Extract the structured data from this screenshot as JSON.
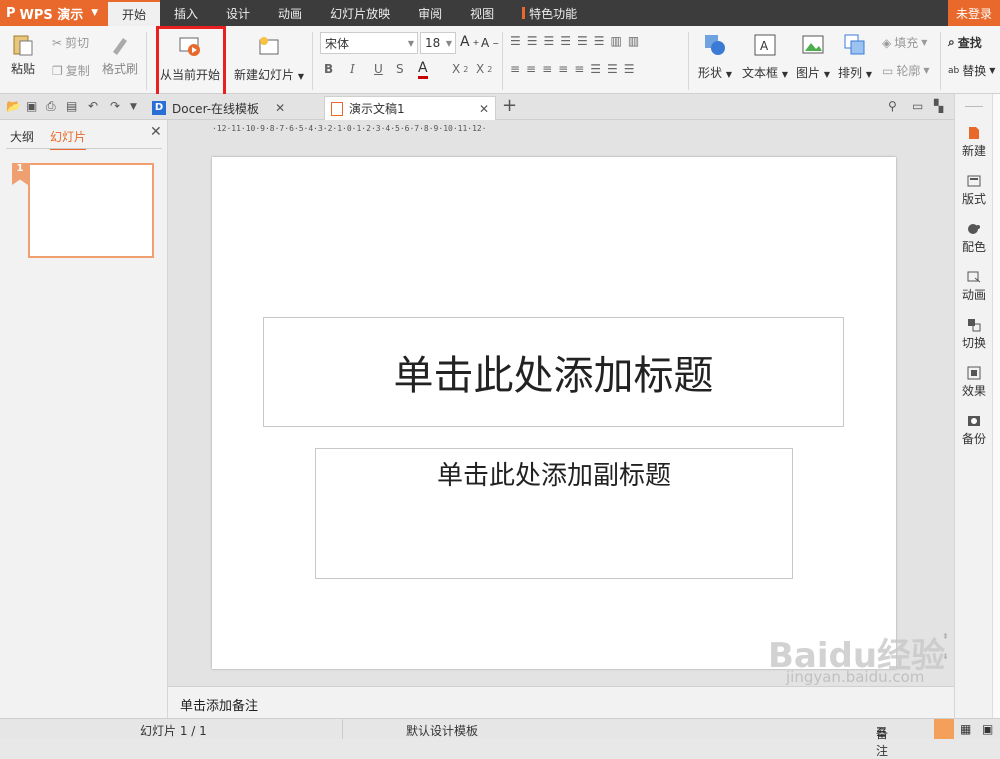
{
  "app": {
    "name": "WPS 演示",
    "login": "未登录"
  },
  "menu": [
    "开始",
    "插入",
    "设计",
    "动画",
    "幻灯片放映",
    "审阅",
    "视图",
    "特色功能"
  ],
  "ribbon": {
    "paste": "粘贴",
    "cut": "剪切",
    "copy": "复制",
    "format_painter": "格式刷",
    "from_current": "从当前开始",
    "new_slide": "新建幻灯片",
    "font": "宋体",
    "font_size": "18",
    "shape": "形状",
    "textbox": "文本框",
    "picture": "图片",
    "arrange": "排列",
    "fill": "填充",
    "outline": "轮廓",
    "find": "查找",
    "replace": "替换"
  },
  "doc_tabs": [
    "Docer-在线模板",
    "演示文稿1"
  ],
  "left_pane": {
    "tabs": [
      "大纲",
      "幻灯片"
    ],
    "slide_number": "1"
  },
  "ruler": "·12·11·10·9·8·7·6·5·4·3·2·1·0·1·2·3·4·5·6·7·8·9·10·11·12·",
  "slide": {
    "title_placeholder": "单击此处添加标题",
    "subtitle_placeholder": "单击此处添加副标题"
  },
  "notes_placeholder": "单击添加备注",
  "right_sidebar": [
    "新建",
    "版式",
    "配色",
    "动画",
    "切换",
    "效果",
    "备份"
  ],
  "status": {
    "slide_count": "幻灯片 1 / 1",
    "template": "默认设计模板",
    "notes": "备注"
  },
  "watermark": {
    "brand": "Baidu经验",
    "url": "jingyan.baidu.com"
  },
  "colors": {
    "accent": "#e8692b",
    "highlight": "#e82020",
    "menubar": "#3c3c3c"
  }
}
